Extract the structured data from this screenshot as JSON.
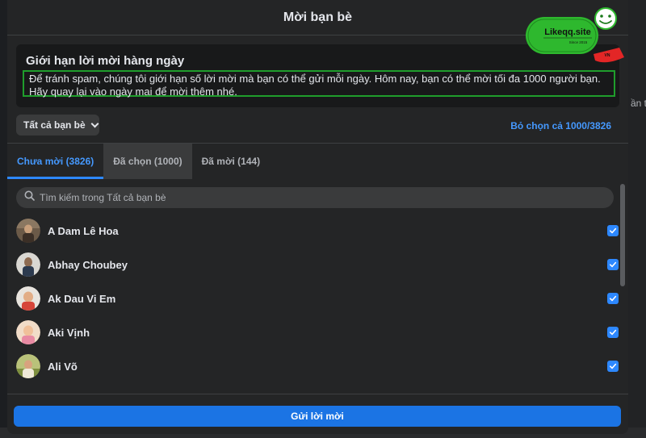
{
  "dialog": {
    "title": "Mời bạn bè"
  },
  "notice": {
    "title": "Giới hạn lời mời hàng ngày",
    "body": "Để tránh spam, chúng tôi giới hạn số lời mời mà bạn có thể gửi mỗi ngày. Hôm nay, bạn có thể mời tối đa 1000 người bạn. Hãy quay lại vào ngày mai để mời thêm nhé."
  },
  "filter": {
    "label": "Tất cả bạn bè"
  },
  "deselect": {
    "label": "Bỏ chọn cả 1000/3826"
  },
  "tabs": [
    {
      "label": "Chưa mời (3826)"
    },
    {
      "label": "Đã chọn (1000)"
    },
    {
      "label": "Đã mời (144)"
    }
  ],
  "search": {
    "placeholder": "Tìm kiếm trong Tất cả bạn bè"
  },
  "friends": [
    {
      "name": "A Dam Lê Hoa",
      "checked": true
    },
    {
      "name": "Abhay Choubey",
      "checked": true
    },
    {
      "name": "Ak Dau Vi Em",
      "checked": true
    },
    {
      "name": "Aki Vịnh",
      "checked": true
    },
    {
      "name": "Ali Võ",
      "checked": true
    }
  ],
  "send_button": {
    "label": "Gửi lời mời"
  },
  "background": {
    "partial_text": "ần t"
  },
  "watermark": {
    "brand": "Likeqq.site",
    "tagline": "Since 2015",
    "tag": "VN"
  },
  "colors": {
    "accent": "#2d88ff",
    "highlight_border": "#1f9e2c",
    "link": "#4599ff"
  }
}
